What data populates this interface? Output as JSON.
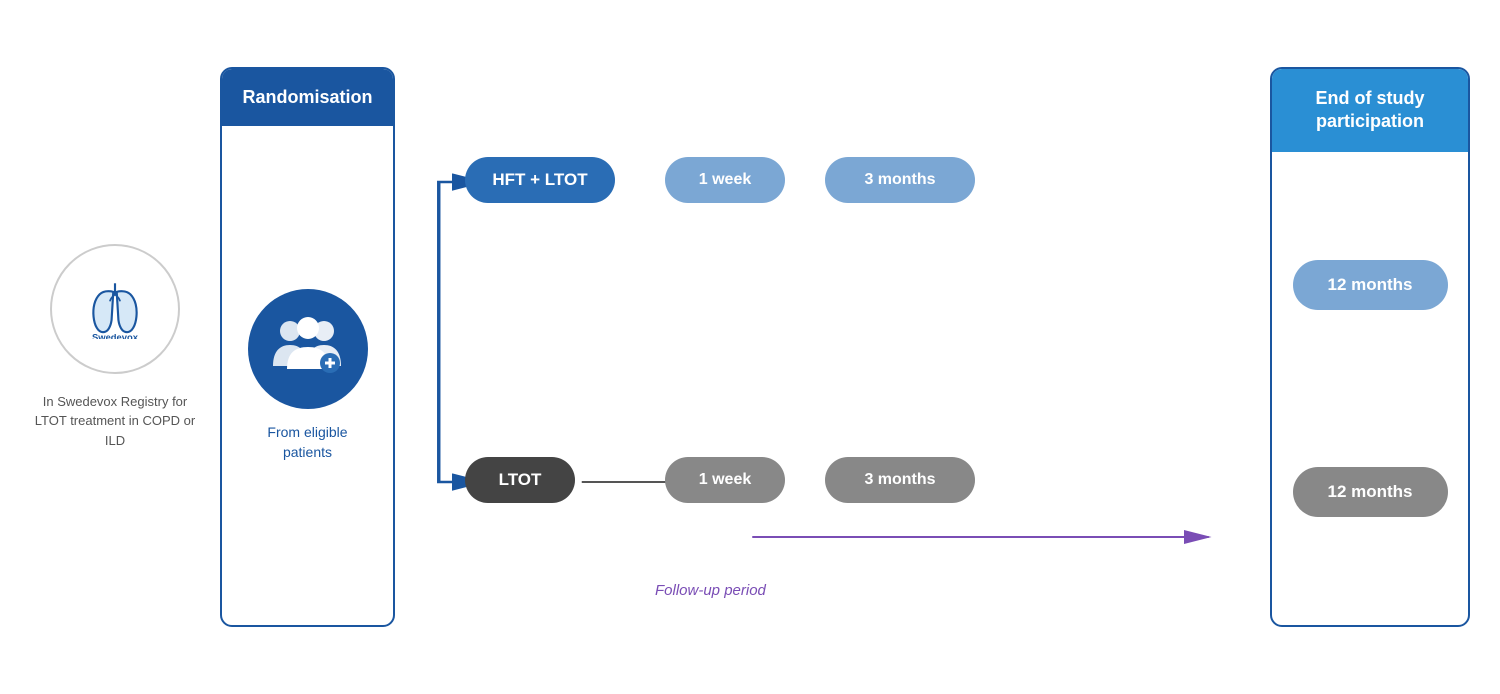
{
  "logo": {
    "name": "Swedevox",
    "caption": "In Swedevox Registry for LTOT treatment in COPD or ILD"
  },
  "randomisation": {
    "header": "Randomisation",
    "patients_label": "From eligible patients"
  },
  "flow": {
    "top_arm": {
      "label": "HFT + LTOT",
      "step1": "1 week",
      "step2": "3 months"
    },
    "bottom_arm": {
      "label": "LTOT",
      "step1": "1 week",
      "step2": "3 months"
    },
    "followup_label": "Follow-up period"
  },
  "end_of_study": {
    "header": "End of study participation",
    "top_badge": "12 months",
    "bottom_badge": "12 months"
  }
}
